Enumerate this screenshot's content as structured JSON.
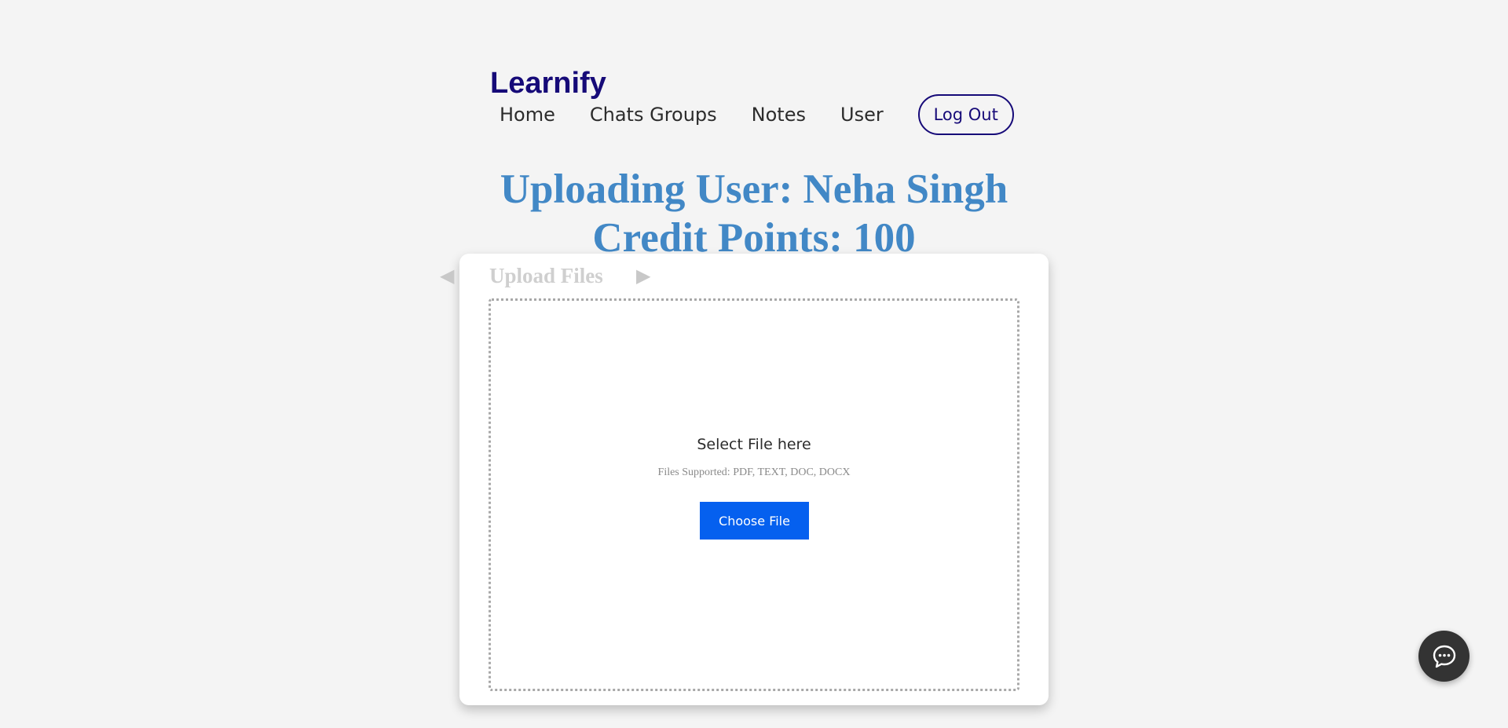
{
  "header": {
    "logo": "Learnify",
    "nav": [
      {
        "label": "Home"
      },
      {
        "label": "Chats Groups"
      },
      {
        "label": "Notes"
      },
      {
        "label": "User"
      }
    ],
    "logout_label": "Log Out"
  },
  "titles": {
    "uploading_user": "Uploading User: Neha Singh",
    "credit_points": "Credit Points: 100"
  },
  "upload": {
    "title": "Upload Files",
    "select_label": "Select File here",
    "supported": "Files Supported: PDF, TEXT, DOC, DOCX",
    "choose_label": "Choose File"
  },
  "icons": {
    "prev": "triangle-left-icon",
    "next": "triangle-right-icon",
    "chat": "chat-bubble-icon"
  },
  "colors": {
    "brand": "#160a78",
    "title": "#4288c6",
    "primary_button": "#0560ef",
    "chat_button": "#333333"
  }
}
